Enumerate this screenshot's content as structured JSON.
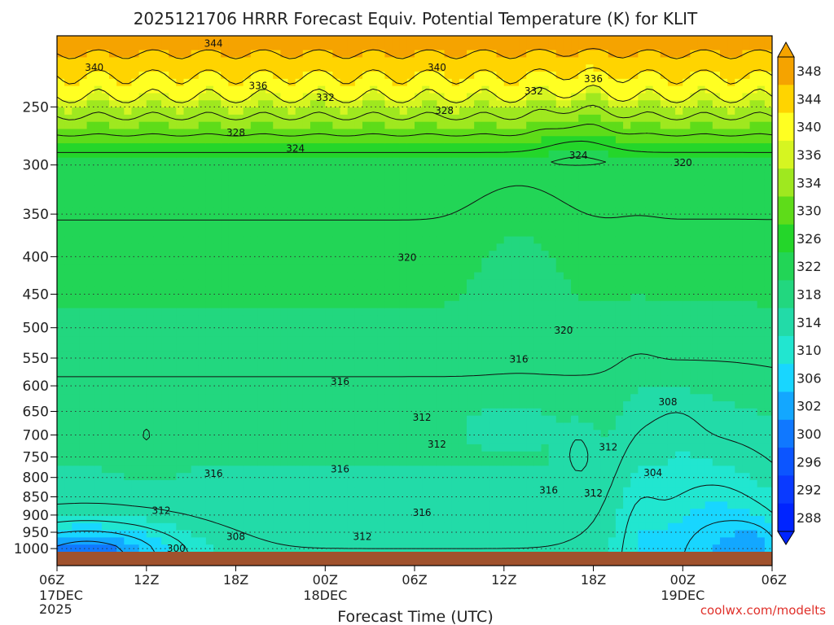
{
  "chart_data": {
    "type": "heatmap",
    "title": "2025121706 HRRR Forecast Equiv. Potential Temperature (K) for KLIT",
    "xlabel": "Forecast Time (UTC)",
    "ylabel": "",
    "credit": "coolwx.com/modelts",
    "x_ticks": [
      {
        "hour": 0,
        "label": "06Z",
        "sub": [
          "17DEC",
          "2025"
        ]
      },
      {
        "hour": 6,
        "label": "12Z",
        "sub": []
      },
      {
        "hour": 12,
        "label": "18Z",
        "sub": []
      },
      {
        "hour": 18,
        "label": "00Z",
        "sub": [
          "18DEC"
        ]
      },
      {
        "hour": 24,
        "label": "06Z",
        "sub": []
      },
      {
        "hour": 30,
        "label": "12Z",
        "sub": []
      },
      {
        "hour": 36,
        "label": "18Z",
        "sub": []
      },
      {
        "hour": 42,
        "label": "00Z",
        "sub": [
          "19DEC"
        ]
      },
      {
        "hour": 48,
        "label": "06Z",
        "sub": []
      }
    ],
    "xlim": [
      0,
      48
    ],
    "y_ticks": [
      250,
      300,
      350,
      400,
      450,
      500,
      550,
      600,
      650,
      700,
      750,
      800,
      850,
      900,
      950,
      1000
    ],
    "y_units": "hPa",
    "y_scale": "log",
    "ylim": [
      1010,
      200
    ],
    "colorbar": {
      "unit": "K",
      "labels": [
        348,
        344,
        340,
        336,
        334,
        330,
        326,
        322,
        318,
        314,
        310,
        306,
        302,
        300,
        296,
        292,
        288
      ],
      "colors": [
        "#f5a300",
        "#ffd400",
        "#ffff22",
        "#d6f521",
        "#9fe81f",
        "#5edc19",
        "#24d62a",
        "#22d556",
        "#22d77f",
        "#22dba8",
        "#21e6d0",
        "#18d6ff",
        "#13a7ff",
        "#1078ff",
        "#0c55ff",
        "#0a3aff",
        "#0024ff"
      ],
      "extend": "both"
    },
    "contour_interval": 4,
    "contour_labels": [
      {
        "value": 344,
        "hour": 10.5,
        "p": 205
      },
      {
        "value": 340,
        "hour": 2.5,
        "p": 221
      },
      {
        "value": 340,
        "hour": 25.5,
        "p": 221
      },
      {
        "value": 336,
        "hour": 13.5,
        "p": 234
      },
      {
        "value": 336,
        "hour": 36,
        "p": 229
      },
      {
        "value": 332,
        "hour": 18,
        "p": 243
      },
      {
        "value": 332,
        "hour": 32,
        "p": 238
      },
      {
        "value": 328,
        "hour": 12,
        "p": 271
      },
      {
        "value": 328,
        "hour": 26,
        "p": 253
      },
      {
        "value": 324,
        "hour": 16,
        "p": 285
      },
      {
        "value": 324,
        "hour": 35,
        "p": 291
      },
      {
        "value": 320,
        "hour": 42,
        "p": 298
      },
      {
        "value": 320,
        "hour": 23.5,
        "p": 401
      },
      {
        "value": 320,
        "hour": 34,
        "p": 504
      },
      {
        "value": 316,
        "hour": 31,
        "p": 552
      },
      {
        "value": 316,
        "hour": 19,
        "p": 592
      },
      {
        "value": 316,
        "hour": 10.5,
        "p": 790
      },
      {
        "value": 316,
        "hour": 19,
        "p": 779
      },
      {
        "value": 316,
        "hour": 33,
        "p": 833
      },
      {
        "value": 316,
        "hour": 24.5,
        "p": 894
      },
      {
        "value": 312,
        "hour": 24.5,
        "p": 663
      },
      {
        "value": 312,
        "hour": 25.5,
        "p": 721
      },
      {
        "value": 312,
        "hour": 37,
        "p": 727
      },
      {
        "value": 312,
        "hour": 36,
        "p": 840
      },
      {
        "value": 312,
        "hour": 7,
        "p": 888
      },
      {
        "value": 312,
        "hour": 20.5,
        "p": 963
      },
      {
        "value": 308,
        "hour": 12,
        "p": 963
      },
      {
        "value": 308,
        "hour": 41,
        "p": 631
      },
      {
        "value": 304,
        "hour": 40,
        "p": 788
      },
      {
        "value": 300,
        "hour": 8,
        "p": 1000
      }
    ]
  }
}
